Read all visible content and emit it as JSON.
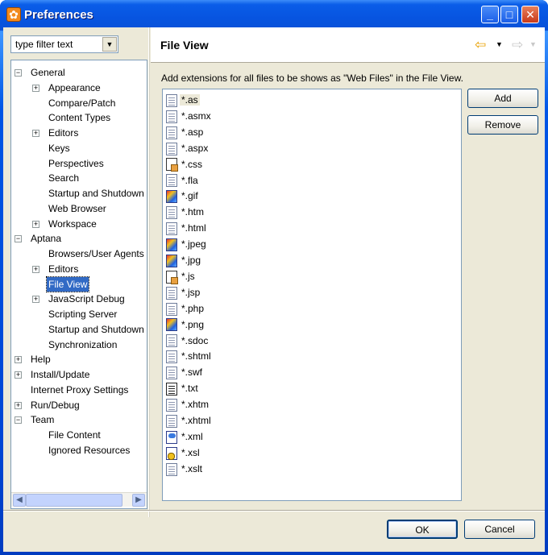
{
  "window": {
    "title": "Preferences"
  },
  "filter": {
    "value": "type filter text"
  },
  "tree": [
    {
      "label": "General",
      "depth": 0,
      "toggle": "minus"
    },
    {
      "label": "Appearance",
      "depth": 1,
      "toggle": "plus"
    },
    {
      "label": "Compare/Patch",
      "depth": 1,
      "toggle": "none"
    },
    {
      "label": "Content Types",
      "depth": 1,
      "toggle": "none"
    },
    {
      "label": "Editors",
      "depth": 1,
      "toggle": "plus"
    },
    {
      "label": "Keys",
      "depth": 1,
      "toggle": "none"
    },
    {
      "label": "Perspectives",
      "depth": 1,
      "toggle": "none"
    },
    {
      "label": "Search",
      "depth": 1,
      "toggle": "none"
    },
    {
      "label": "Startup and Shutdown",
      "depth": 1,
      "toggle": "none"
    },
    {
      "label": "Web Browser",
      "depth": 1,
      "toggle": "none"
    },
    {
      "label": "Workspace",
      "depth": 1,
      "toggle": "plus"
    },
    {
      "label": "Aptana",
      "depth": 0,
      "toggle": "minus"
    },
    {
      "label": "Browsers/User Agents",
      "depth": 1,
      "toggle": "none"
    },
    {
      "label": "Editors",
      "depth": 1,
      "toggle": "plus"
    },
    {
      "label": "File View",
      "depth": 1,
      "toggle": "none",
      "selected": true
    },
    {
      "label": "JavaScript Debug",
      "depth": 1,
      "toggle": "plus"
    },
    {
      "label": "Scripting Server",
      "depth": 1,
      "toggle": "none"
    },
    {
      "label": "Startup and Shutdown",
      "depth": 1,
      "toggle": "none"
    },
    {
      "label": "Synchronization",
      "depth": 1,
      "toggle": "none"
    },
    {
      "label": "Help",
      "depth": 0,
      "toggle": "plus"
    },
    {
      "label": "Install/Update",
      "depth": 0,
      "toggle": "plus"
    },
    {
      "label": "Internet Proxy Settings",
      "depth": 0,
      "toggle": "none"
    },
    {
      "label": "Run/Debug",
      "depth": 0,
      "toggle": "plus"
    },
    {
      "label": "Team",
      "depth": 0,
      "toggle": "minus"
    },
    {
      "label": "File Content",
      "depth": 1,
      "toggle": "none"
    },
    {
      "label": "Ignored Resources",
      "depth": 1,
      "toggle": "none"
    }
  ],
  "page": {
    "title": "File View",
    "description": "Add extensions for all files to be shows as \"Web Files\" in the File View."
  },
  "files": [
    {
      "name": "*.as",
      "icon": "doc",
      "selected": true
    },
    {
      "name": "*.asmx",
      "icon": "doc"
    },
    {
      "name": "*.asp",
      "icon": "doc"
    },
    {
      "name": "*.aspx",
      "icon": "doc"
    },
    {
      "name": "*.css",
      "icon": "blank"
    },
    {
      "name": "*.fla",
      "icon": "doc"
    },
    {
      "name": "*.gif",
      "icon": "image"
    },
    {
      "name": "*.htm",
      "icon": "doc"
    },
    {
      "name": "*.html",
      "icon": "doc"
    },
    {
      "name": "*.jpeg",
      "icon": "image"
    },
    {
      "name": "*.jpg",
      "icon": "image"
    },
    {
      "name": "*.js",
      "icon": "blank"
    },
    {
      "name": "*.jsp",
      "icon": "doc"
    },
    {
      "name": "*.php",
      "icon": "doc"
    },
    {
      "name": "*.png",
      "icon": "image"
    },
    {
      "name": "*.sdoc",
      "icon": "doc"
    },
    {
      "name": "*.shtml",
      "icon": "doc"
    },
    {
      "name": "*.swf",
      "icon": "doc"
    },
    {
      "name": "*.txt",
      "icon": "txt"
    },
    {
      "name": "*.xhtm",
      "icon": "doc"
    },
    {
      "name": "*.xhtml",
      "icon": "doc"
    },
    {
      "name": "*.xml",
      "icon": "xml"
    },
    {
      "name": "*.xsl",
      "icon": "xsl"
    },
    {
      "name": "*.xslt",
      "icon": "doc"
    }
  ],
  "buttons": {
    "add": "Add",
    "remove": "Remove",
    "ok": "OK",
    "cancel": "Cancel"
  },
  "icons": {
    "nav_back": "arrow-left-icon",
    "nav_forward": "arrow-right-icon",
    "app": "preferences-gear-icon"
  }
}
